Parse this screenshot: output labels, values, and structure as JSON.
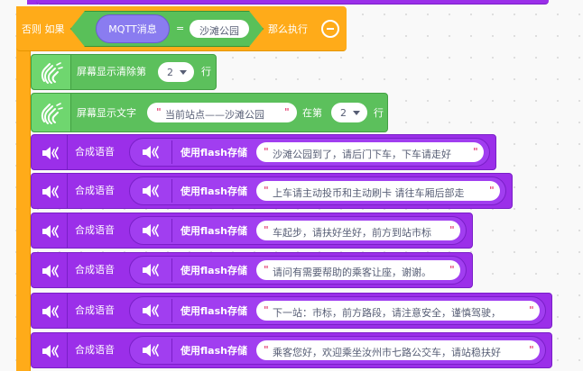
{
  "if_block": {
    "else_if_label": "否则 如果",
    "then_label": "那么执行"
  },
  "condition": {
    "left_value": "MQTT消息",
    "operator": "=",
    "right_value": "沙滩公园"
  },
  "clear_block": {
    "label": "屏幕显示清除第",
    "row_value": "2",
    "suffix": "行"
  },
  "show_text_block": {
    "label": "屏幕显示文字",
    "text": "当前站点——沙滩公园",
    "at_label": "在第",
    "row_value": "2",
    "suffix": "行"
  },
  "speech_blocks": [
    {
      "label": "合成语音",
      "store_label": "使用flash存储",
      "text": "沙滩公园到了，请后门下车，下车请走好"
    },
    {
      "label": "合成语音",
      "store_label": "使用flash存储",
      "text": "上车请主动投币和主动刷卡 请往车厢后部走"
    },
    {
      "label": "合成语音",
      "store_label": "使用flash存储",
      "text": "车起步，请扶好坐好，前方到站市标"
    },
    {
      "label": "合成语音",
      "store_label": "使用flash存储",
      "text": "请问有需要帮助的乘客让座，谢谢。"
    },
    {
      "label": "合成语音",
      "store_label": "使用flash存储",
      "text": "下一站：市标，前方路段，请注意安全，谨慎驾驶，"
    },
    {
      "label": "合成语音",
      "store_label": "使用flash存储",
      "text": "乘客您好，欢迎乘坐汝州市七路公交车，请站稳扶好"
    }
  ],
  "colors": {
    "control_orange": "#ffab19",
    "operator_green": "#59c059",
    "display_green": "#5cc05c",
    "speech_purple": "#9b2fe9",
    "mqtt_purple": "#8a7cf0",
    "quote_pink": "#e64a7a"
  },
  "icons": [
    "remove-branch-icon",
    "dropdown-arrow-icon",
    "hand-wave-icon",
    "speaker-icon"
  ]
}
